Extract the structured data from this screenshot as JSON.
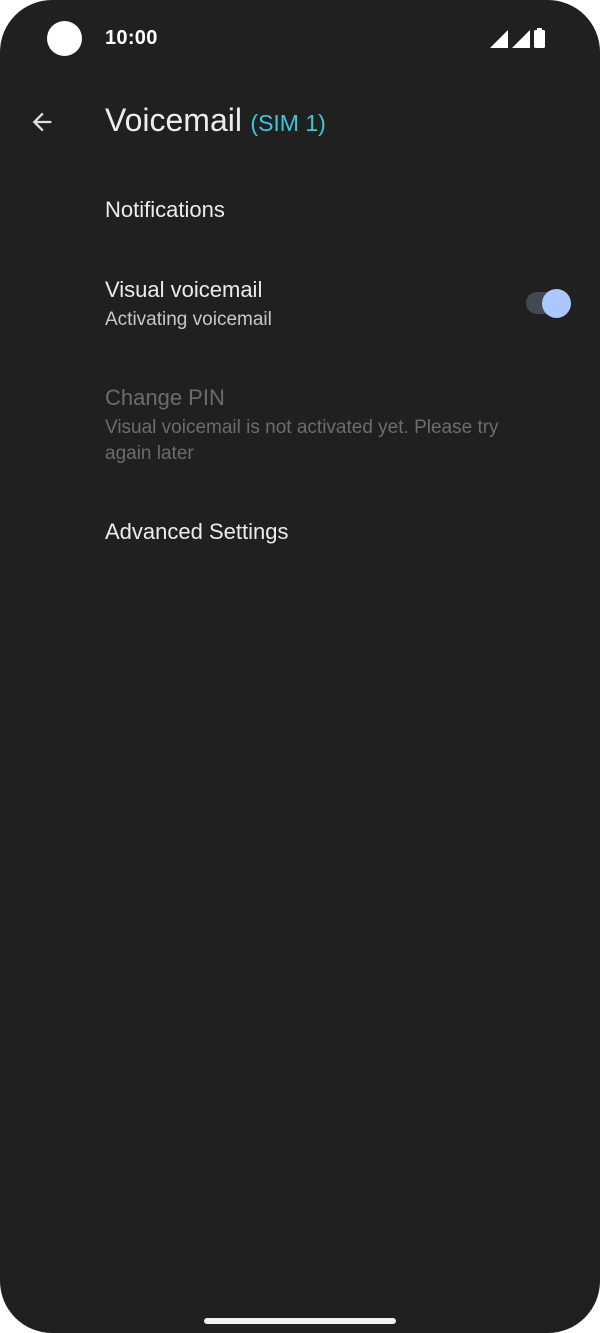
{
  "status_bar": {
    "time": "10:00",
    "icons": [
      "signal-icon",
      "signal-icon",
      "battery-icon"
    ]
  },
  "app_bar": {
    "back_icon": "arrow-back-icon",
    "title": "Voicemail",
    "subtitle": "(SIM 1)"
  },
  "preferences": {
    "notifications": {
      "title": "Notifications"
    },
    "visual_voicemail": {
      "title": "Visual voicemail",
      "summary": "Activating voicemail",
      "toggle_on": true
    },
    "change_pin": {
      "title": "Change PIN",
      "summary": "Visual voicemail is not activated yet. Please try again later",
      "enabled": false
    },
    "advanced_settings": {
      "title": "Advanced Settings"
    }
  },
  "colors": {
    "background": "#202020",
    "accent_cyan": "#3fc6d6",
    "toggle_thumb": "#abc7ff",
    "toggle_track": "#45484f"
  }
}
